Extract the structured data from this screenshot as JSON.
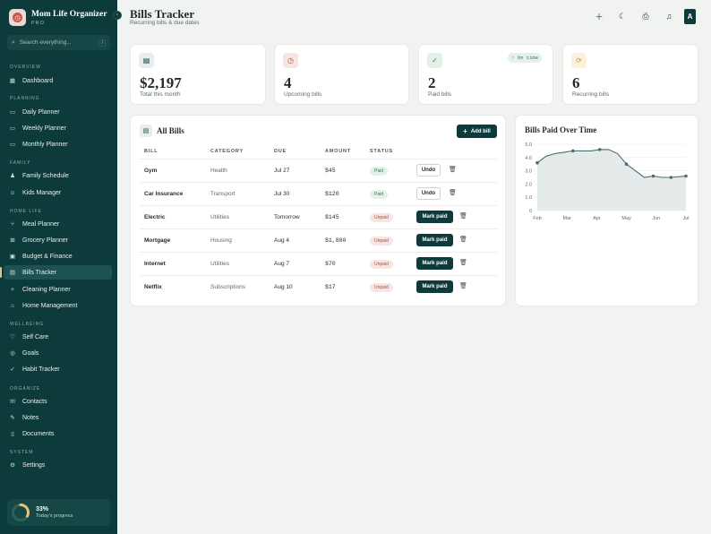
{
  "app": {
    "title": "Mom Life Organizer",
    "tier": "PRO"
  },
  "search": {
    "placeholder": "Search everything...",
    "shortcut": "/"
  },
  "sidebar": {
    "sections": [
      {
        "label": "OVERVIEW",
        "items": [
          {
            "label": "Dashboard",
            "icon": "grid-icon"
          }
        ]
      },
      {
        "label": "PLANNING",
        "items": [
          {
            "label": "Daily Planner",
            "icon": "calendar-icon"
          },
          {
            "label": "Weekly Planner",
            "icon": "calendar-icon"
          },
          {
            "label": "Monthly Planner",
            "icon": "calendar-icon"
          }
        ]
      },
      {
        "label": "FAMILY",
        "items": [
          {
            "label": "Family Schedule",
            "icon": "users-icon"
          },
          {
            "label": "Kids Manager",
            "icon": "baby-icon"
          }
        ]
      },
      {
        "label": "HOME LIFE",
        "items": [
          {
            "label": "Meal Planner",
            "icon": "utensils-icon"
          },
          {
            "label": "Grocery Planner",
            "icon": "cart-icon"
          },
          {
            "label": "Budget & Finance",
            "icon": "wallet-icon"
          },
          {
            "label": "Bills Tracker",
            "icon": "receipt-icon",
            "active": true
          },
          {
            "label": "Cleaning Planner",
            "icon": "sparkle-icon"
          },
          {
            "label": "Home Management",
            "icon": "home-icon"
          }
        ]
      },
      {
        "label": "WELLBEING",
        "items": [
          {
            "label": "Self Care",
            "icon": "heart-icon"
          },
          {
            "label": "Goals",
            "icon": "target-icon"
          },
          {
            "label": "Habit Tracker",
            "icon": "check-icon"
          }
        ]
      },
      {
        "label": "ORGANIZE",
        "items": [
          {
            "label": "Contacts",
            "icon": "phone-icon"
          },
          {
            "label": "Notes",
            "icon": "note-icon"
          },
          {
            "label": "Documents",
            "icon": "file-icon"
          }
        ]
      },
      {
        "label": "SYSTEM",
        "items": [
          {
            "label": "Settings",
            "icon": "gear-icon"
          }
        ]
      }
    ]
  },
  "progress": {
    "percent_label": "33%",
    "label": "Today's progress",
    "value": 0.33
  },
  "header": {
    "title": "Bills Tracker",
    "subtitle": "Recurring bills & due dates"
  },
  "stats": [
    {
      "value": "$2,197",
      "label": "Total this month",
      "icon": "receipt-icon"
    },
    {
      "value": "4",
      "label": "Upcoming bills",
      "icon": "clock-icon"
    },
    {
      "value": "2",
      "label": "Paid bills",
      "icon": "check-icon",
      "badge": "On time"
    },
    {
      "value": "6",
      "label": "Recurring bills",
      "icon": "repeat-icon"
    }
  ],
  "bills_panel": {
    "title": "All Bills",
    "add_label": "Add bill",
    "columns": [
      "BILL",
      "CATEGORY",
      "DUE",
      "AMOUNT",
      "STATUS"
    ],
    "rows": [
      {
        "bill": "Gym",
        "category": "Health",
        "due": "Jul 27",
        "amount": "$45",
        "status": "Paid",
        "action": "Undo"
      },
      {
        "bill": "Car Insurance",
        "category": "Transport",
        "due": "Jul 30",
        "amount": "$120",
        "status": "Paid",
        "action": "Undo"
      },
      {
        "bill": "Electric",
        "category": "Utilities",
        "due": "Tomorrow",
        "amount": "$145",
        "status": "Unpaid",
        "action": "Mark paid"
      },
      {
        "bill": "Mortgage",
        "category": "Housing",
        "due": "Aug 4",
        "amount": "$1,800",
        "status": "Unpaid",
        "action": "Mark paid"
      },
      {
        "bill": "Internet",
        "category": "Utilities",
        "due": "Aug 7",
        "amount": "$70",
        "status": "Unpaid",
        "action": "Mark paid"
      },
      {
        "bill": "Netflix",
        "category": "Subscriptions",
        "due": "Aug 10",
        "amount": "$17",
        "status": "Unpaid",
        "action": "Mark paid"
      }
    ]
  },
  "colors": {
    "sidebar": "#0d3b3b",
    "accent": "#0d3b3b",
    "paid": "#2e7b4f",
    "unpaid": "#b24a3d",
    "chart_line": "#4a6f6f"
  },
  "chart_data": {
    "type": "area",
    "title": "Bills Paid Over Time",
    "categories": [
      "Feb",
      "Mar",
      "Apr",
      "May",
      "Jun",
      "Jul"
    ],
    "x": [
      0,
      0.3,
      0.6,
      0.9,
      1.2,
      1.5,
      1.8,
      2.1,
      2.4,
      2.7,
      3.0,
      3.3,
      3.6,
      3.9,
      4.2,
      4.5,
      5.0
    ],
    "series": [
      {
        "values": [
          3.6,
          4.1,
          4.3,
          4.4,
          4.5,
          4.5,
          4.5,
          4.6,
          4.6,
          4.3,
          3.5,
          3.0,
          2.5,
          2.6,
          2.5,
          2.5,
          2.6
        ]
      }
    ],
    "ylim": [
      0,
      5
    ],
    "yticks": [
      "5.0",
      "4.0",
      "3.0",
      "2.0",
      "1.0",
      "0"
    ],
    "grid": true
  }
}
